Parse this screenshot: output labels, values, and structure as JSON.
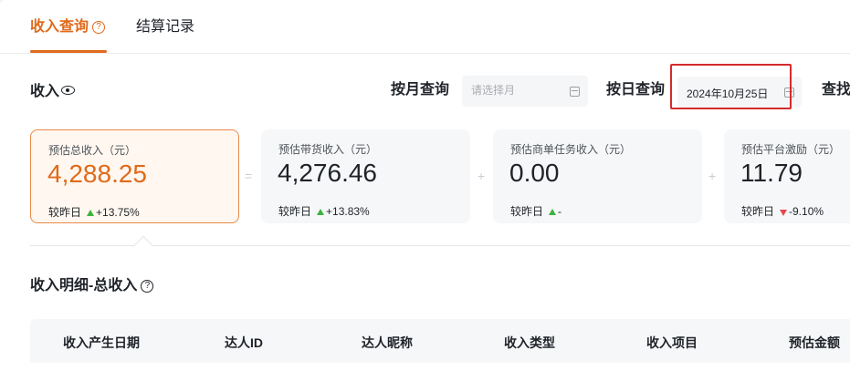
{
  "tabs": {
    "income_query": "收入查询",
    "settlement_records": "结算记录"
  },
  "header": {
    "income_title": "收入",
    "query_by_month_label": "按月查询",
    "month_placeholder": "请选择月",
    "query_by_day_label": "按日查询",
    "day_value": "2024年10月25日",
    "search_label": "查找"
  },
  "cards": [
    {
      "label": "预估总收入（元）",
      "value": "4,288.25",
      "compare_label": "较昨日",
      "trend": "up",
      "change": "+13.75%"
    },
    {
      "label": "预估带货收入（元）",
      "value": "4,276.46",
      "compare_label": "较昨日",
      "trend": "up",
      "change": "+13.83%"
    },
    {
      "label": "预估商单任务收入（元）",
      "value": "0.00",
      "compare_label": "较昨日",
      "trend": "up",
      "change": "-"
    },
    {
      "label": "预估平台激励（元）",
      "value": "11.79",
      "compare_label": "较昨日",
      "trend": "down",
      "change": "-9.10%"
    }
  ],
  "operators": [
    "=",
    "+",
    "+"
  ],
  "detail": {
    "title": "收入明细-总收入",
    "columns": [
      "收入产生日期",
      "达人ID",
      "达人昵称",
      "收入类型",
      "收入项目",
      "预估金额"
    ]
  },
  "colors": {
    "accent": "#e06a1b",
    "up": "#3bb33b",
    "down": "#e5484d",
    "highlight_box": "#d42b2b"
  }
}
